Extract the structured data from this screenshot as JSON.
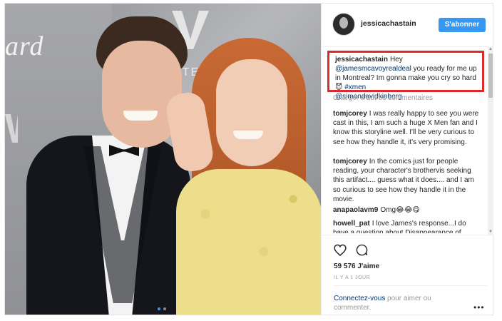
{
  "photo": {
    "brand_text": "ard",
    "logo_text": "STEI",
    "carousel": {
      "count": 2,
      "active_index": 0
    }
  },
  "header": {
    "username": "jessicachastain",
    "follow_label": "S'abonner"
  },
  "caption": {
    "username": "jessicachastain",
    "text_1": "Hey ",
    "mention_1": "@jamesmcavoyrealdeal",
    "text_2": " you ready for me up in Montreal? Im gonna make you cry so hard 😈 ",
    "hashtag": "#xmen",
    "mention_2": "@simondavidkinberg"
  },
  "load_more": "Charger d’autres commentaires",
  "comments": [
    {
      "username": "tomjcorey",
      "text": "I was really happy to see you were cast in this, I am such a huge X Men fan and I know this storyline well. I'll be very curious to see how they handle it, it's very promising."
    },
    {
      "username": "tomjcorey",
      "text": "In the comics just for people reading, your character's brothervis seeking this artifact.... guess what it does.... and I am so curious to see how they handle it in the movie."
    },
    {
      "username": "anapaolavm9",
      "text": "Omg😂😂😋"
    },
    {
      "username": "howell_pat",
      "text": "I love James's response...I do have a question about Disappearance of Eleanor Rigby though! At the end of the"
    }
  ],
  "likes": "59 576 J'aime",
  "timestamp": "IL Y A 1 JOUR",
  "login_prompt": {
    "link": "Connectez-vous",
    "text": " pour aimer ou commenter."
  },
  "more_label": "•••",
  "colors": {
    "accent": "#3897f0",
    "highlight_border": "#d92b2b",
    "link": "#003569"
  }
}
